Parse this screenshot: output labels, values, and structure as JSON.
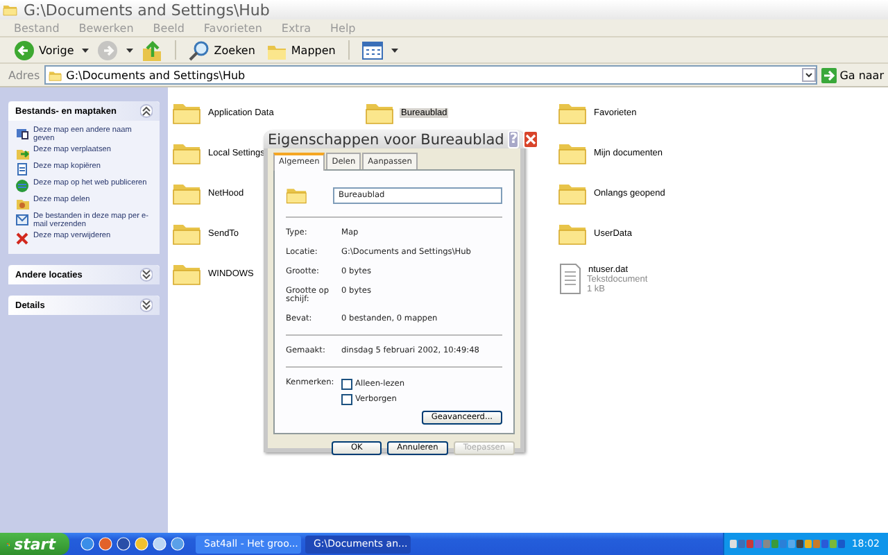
{
  "window": {
    "title": "G:\\Documents and Settings\\Hub"
  },
  "menu": [
    "Bestand",
    "Bewerken",
    "Beeld",
    "Favorieten",
    "Extra",
    "Help"
  ],
  "toolbar": [
    {
      "kind": "back",
      "label": "Vorige",
      "disabled": false
    },
    {
      "kind": "forward",
      "disabled": true
    },
    {
      "kind": "up",
      "disabled": false
    },
    {
      "kind": "search",
      "label": "Zoeken",
      "disabled": false
    },
    {
      "kind": "folders",
      "label": "Mappen",
      "disabled": false
    },
    {
      "kind": "views",
      "disabled": false
    }
  ],
  "address": {
    "label": "Adres",
    "value": "G:\\Documents and Settings\\Hub",
    "go": "Ga naar"
  },
  "sidebar": {
    "panels": [
      {
        "title": "Bestands- en maptaken",
        "expanded": true,
        "items": [
          "Deze map een andere naam geven",
          "Deze map verplaatsen",
          "Deze map kopiëren",
          "Deze map op het web publiceren",
          "Deze map delen",
          "De bestanden in deze map per e-mail verzenden",
          "Deze map verwijderen"
        ]
      },
      {
        "title": "Andere locaties",
        "expanded": false
      },
      {
        "title": "Details",
        "expanded": false
      }
    ]
  },
  "files": {
    "columns": [
      [
        {
          "kind": "folder",
          "name": "Application Data",
          "selected": false
        },
        {
          "kind": "folder",
          "name": "Local Settings",
          "selected": false
        },
        {
          "kind": "folder",
          "name": "NetHood",
          "selected": false
        },
        {
          "kind": "folder",
          "name": "SendTo",
          "selected": false
        },
        {
          "kind": "folder",
          "name": "WINDOWS",
          "selected": false
        }
      ],
      [
        {
          "kind": "folder",
          "name": "Bureaublad",
          "selected": true
        }
      ],
      [
        {
          "kind": "folder",
          "name": "Favorieten",
          "selected": false
        },
        {
          "kind": "folder",
          "name": "Mijn documenten",
          "selected": false
        },
        {
          "kind": "folder",
          "name": "Onlangs geopend",
          "selected": false
        },
        {
          "kind": "folder",
          "name": "UserData",
          "selected": false
        },
        {
          "kind": "file",
          "name": "ntuser.dat",
          "type": "Tekstdocument",
          "size": "1 kB",
          "selected": false
        }
      ]
    ]
  },
  "dialog": {
    "title": "Eigenschappen voor Bureaublad",
    "help": "?",
    "tabs": [
      {
        "label": "Algemeen",
        "selected": true
      },
      {
        "label": "Delen",
        "selected": false
      },
      {
        "label": "Aanpassen",
        "selected": false
      }
    ],
    "name_value": "Bureaublad",
    "property_groups": [
      [
        {
          "label": "Type:",
          "value": "Map"
        },
        {
          "label": "Locatie:",
          "value": "G:\\Documents and Settings\\Hub"
        },
        {
          "label": "Grootte:",
          "value": "0 bytes"
        },
        {
          "label": "Grootte op schijf:",
          "value": "0 bytes"
        },
        {
          "label": "Bevat:",
          "value": "0 bestanden, 0 mappen"
        }
      ],
      [
        {
          "label": "Gemaakt:",
          "value": "dinsdag 5 februari 2002, 10:49:48"
        }
      ]
    ],
    "attributes_label": "Kenmerken:",
    "attributes": [
      {
        "label": "Alleen-lezen",
        "checked": false
      },
      {
        "label": "Verborgen",
        "checked": false
      }
    ],
    "advanced": "Geavanceerd...",
    "buttons": [
      {
        "label": "OK",
        "disabled": false
      },
      {
        "label": "Annuleren",
        "disabled": false
      },
      {
        "label": "Toepassen",
        "disabled": true
      }
    ]
  },
  "taskbar": {
    "start": "start",
    "tasks": [
      {
        "label": "Sat4all - Het groo...",
        "selected": false
      },
      {
        "label": "G:\\Documents an...",
        "selected": true
      }
    ],
    "clock": "18:02"
  }
}
